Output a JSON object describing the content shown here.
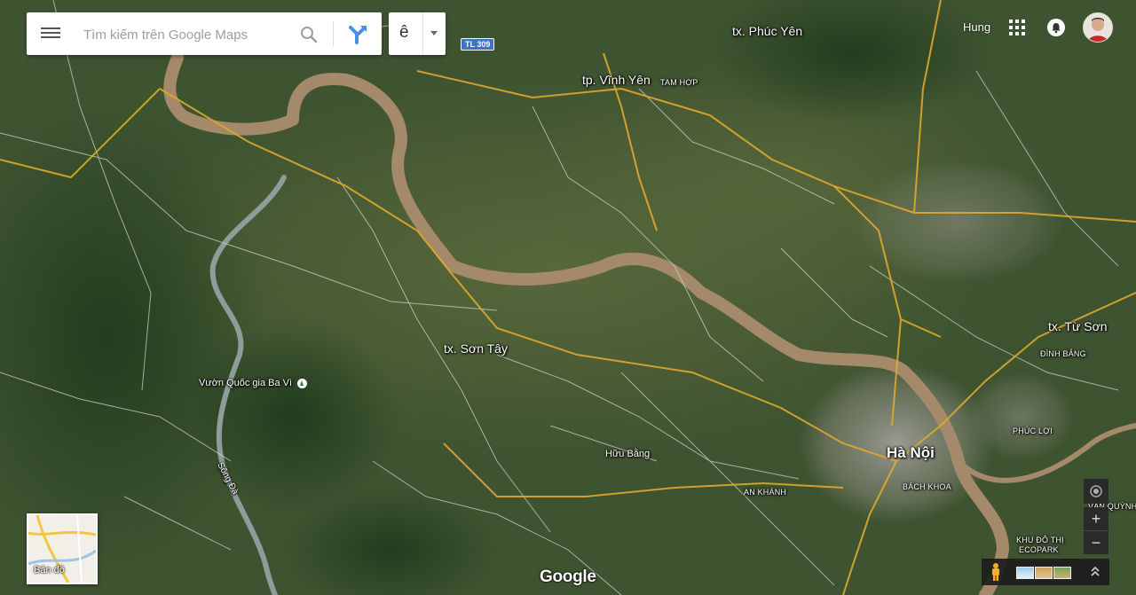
{
  "search": {
    "placeholder": "Tìm kiếm trên Google Maps"
  },
  "language": {
    "label": "ê"
  },
  "account": {
    "name": "Hung"
  },
  "road_shields": [
    {
      "text": "TL 309"
    }
  ],
  "places": {
    "phuc_yen": "tx. Phúc Yên",
    "vinh_yen": "tp. Vĩnh Yên",
    "tam_hop": "TAM HỢP",
    "son_tay": "tx. Sơn Tây",
    "ba_vi": "Vườn Quốc gia Ba Vì",
    "song_da": "Sông Đà",
    "huu_bang": "Hữu Bằng",
    "an_khanh": "AN KHÁNH",
    "ha_noi": "Hà Nội",
    "bach_khoa": "BÁCH KHOA",
    "tu_son": "tx. Từ Sơn",
    "dinh_bang": "ĐÌNH BẢNG",
    "phuc_loi": "PHÚC LỢI",
    "ecopark_1": "KHU ĐÔ THỊ",
    "ecopark_2": "ECOPARK",
    "van_quynh": "VĂN QUỲNH"
  },
  "layer_switcher": {
    "label": "Bản đồ"
  },
  "brand": {
    "logo": "Google"
  },
  "colors": {
    "river": "#a48a6a",
    "major_road": "#e0a92c",
    "minor_road": "#d9d9d9",
    "terrain": "#3b4f2e"
  },
  "icons": {
    "menu": "hamburger-icon",
    "search": "search-icon",
    "directions": "directions-icon",
    "apps": "apps-grid-icon",
    "notifications": "bell-icon",
    "pegman": "pegman-icon",
    "location": "my-location-icon"
  }
}
